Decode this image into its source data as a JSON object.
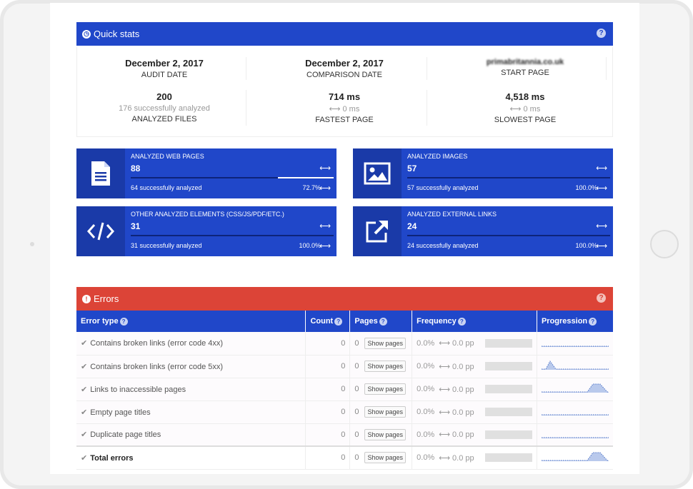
{
  "quick_stats": {
    "title": "Quick stats",
    "help": "?",
    "audit_date": {
      "value": "December 2, 2017",
      "label": "AUDIT DATE"
    },
    "comparison_date": {
      "value": "December 2, 2017",
      "label": "COMPARISON DATE"
    },
    "start_page": {
      "value": "primabritannia.co.uk",
      "label": "START PAGE"
    },
    "analyzed_files": {
      "value": "200",
      "sub": "176 successfully analyzed",
      "label": "ANALYZED FILES"
    },
    "fastest_page": {
      "value": "714 ms",
      "sub": "⟷ 0 ms",
      "label": "FASTEST PAGE"
    },
    "slowest_page": {
      "value": "4,518 ms",
      "sub": "⟷ 0 ms",
      "label": "SLOWEST PAGE"
    }
  },
  "cards": [
    {
      "title": "ANALYZED WEB PAGES",
      "value": "88",
      "sub": "64 successfully analyzed",
      "pct": "72.7%",
      "progress": 0.727,
      "icon": "document-icon"
    },
    {
      "title": "ANALYZED IMAGES",
      "value": "57",
      "sub": "57 successfully analyzed",
      "pct": "100.0%",
      "progress": 1.0,
      "icon": "image-icon"
    },
    {
      "title": "OTHER ANALYZED ELEMENTS (CSS/JS/PDF/ETC.)",
      "value": "31",
      "sub": "31 successfully analyzed",
      "pct": "100.0%",
      "progress": 1.0,
      "icon": "code-icon"
    },
    {
      "title": "ANALYZED EXTERNAL LINKS",
      "value": "24",
      "sub": "24 successfully analyzed",
      "pct": "100.0%",
      "progress": 1.0,
      "icon": "external-link-icon"
    }
  ],
  "arrow": "⟷",
  "errors": {
    "title": "Errors",
    "help": "?",
    "columns": {
      "type": "Error type",
      "count": "Count",
      "pages": "Pages",
      "frequency": "Frequency",
      "progression": "Progression"
    },
    "show_pages_label": "Show pages",
    "rows": [
      {
        "label": "Contains broken links (error code 4xx)",
        "count": "0",
        "pages": "0",
        "freq": "0.0%",
        "delta": "⟷ 0.0 pp",
        "spark": "flat"
      },
      {
        "label": "Contains broken links (error code 5xx)",
        "count": "0",
        "pages": "0",
        "freq": "0.0%",
        "delta": "⟷ 0.0 pp",
        "spark": "peak-left"
      },
      {
        "label": "Links to inaccessible pages",
        "count": "0",
        "pages": "0",
        "freq": "0.0%",
        "delta": "⟷ 0.0 pp",
        "spark": "peak-right"
      },
      {
        "label": "Empty page titles",
        "count": "0",
        "pages": "0",
        "freq": "0.0%",
        "delta": "⟷ 0.0 pp",
        "spark": "flat"
      },
      {
        "label": "Duplicate page titles",
        "count": "0",
        "pages": "0",
        "freq": "0.0%",
        "delta": "⟷ 0.0 pp",
        "spark": "flat"
      }
    ],
    "total": {
      "label": "Total errors",
      "count": "0",
      "pages": "0",
      "freq": "0.0%",
      "delta": "⟷ 0.0 pp",
      "spark": "peak-right"
    }
  },
  "colors": {
    "primary": "#2047c9",
    "danger": "#dc4437"
  }
}
